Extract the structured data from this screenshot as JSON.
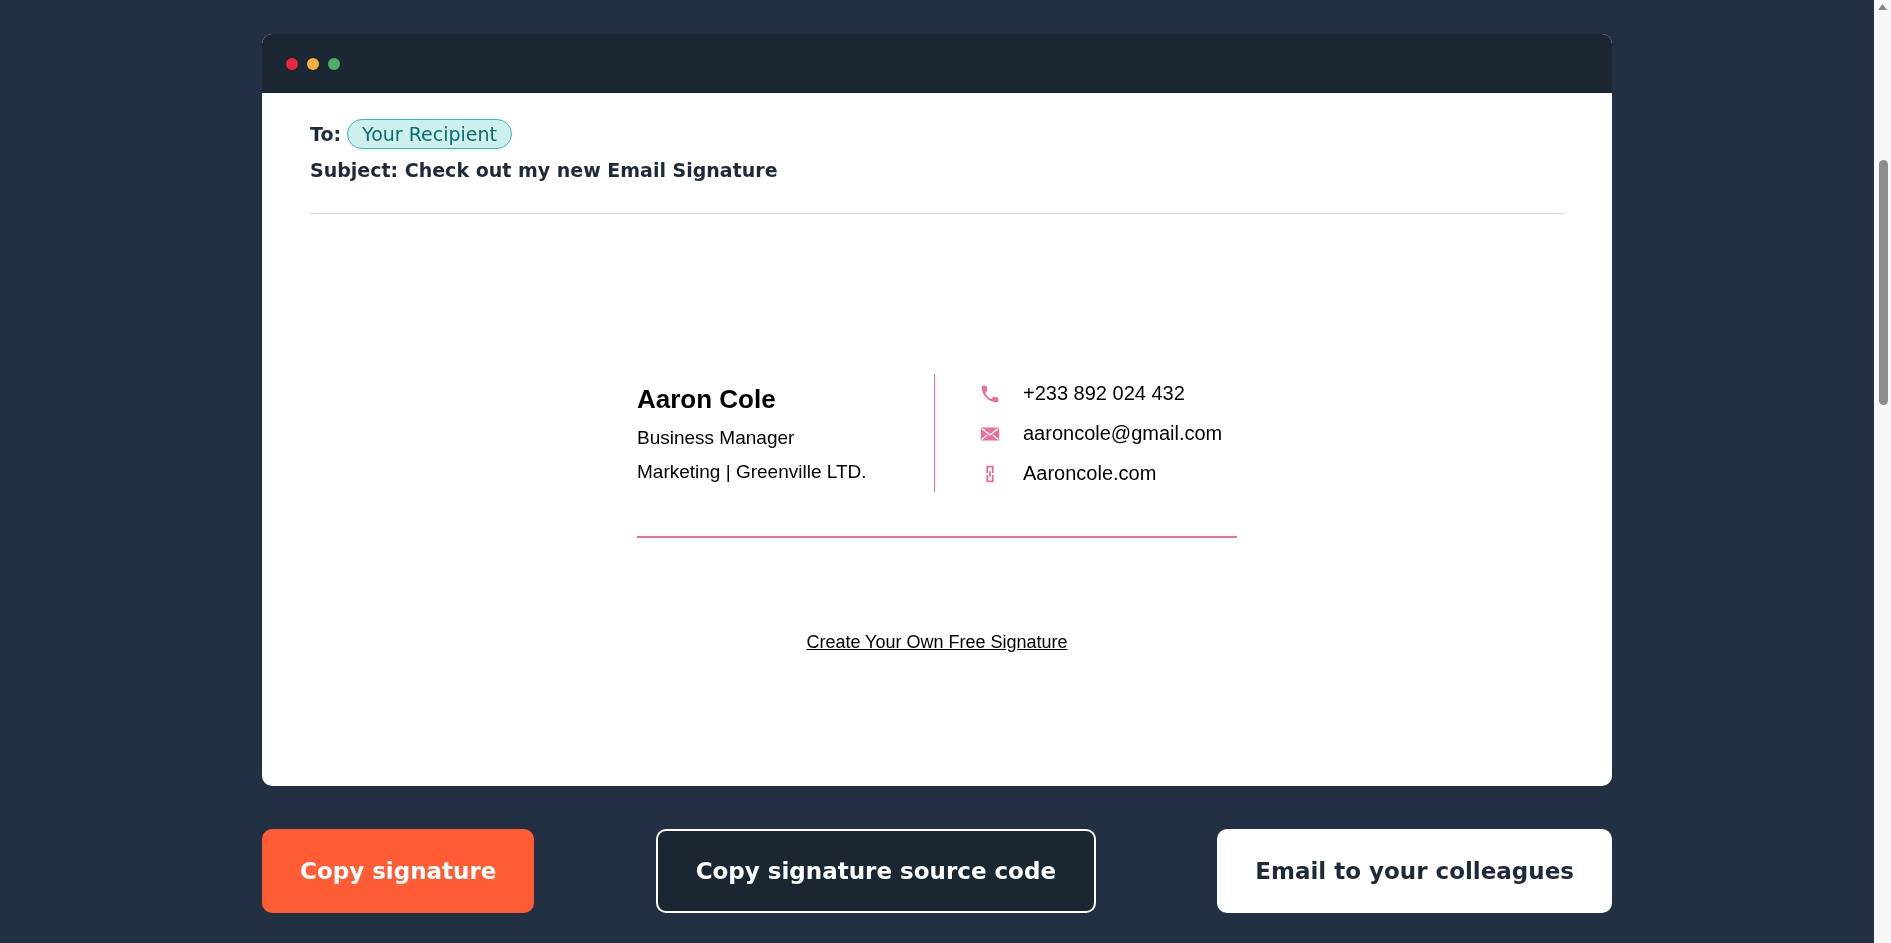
{
  "window": {
    "dots": [
      {
        "color": "#e8293b"
      },
      {
        "color": "#f5b13d"
      },
      {
        "color": "#4caf65"
      }
    ]
  },
  "email": {
    "to_label": "To:",
    "recipient": "Your Recipient",
    "subject": "Subject: Check out my new Email Signature"
  },
  "signature": {
    "name": "Aaron Cole",
    "title": "Business Manager",
    "company": "Marketing | Greenville LTD.",
    "contacts": [
      {
        "kind": "phone",
        "text": "+233 892 024 432"
      },
      {
        "kind": "email",
        "text": "aaroncole@gmail.com"
      },
      {
        "kind": "link",
        "text": "Aaroncole.com"
      }
    ],
    "footer_link": "Create Your Own Free Signature"
  },
  "buttons": [
    {
      "label": "Copy signature",
      "kind": "primary"
    },
    {
      "label": "Copy signature source code",
      "kind": "dark"
    },
    {
      "label": "Email to your colleagues",
      "kind": "light"
    }
  ]
}
